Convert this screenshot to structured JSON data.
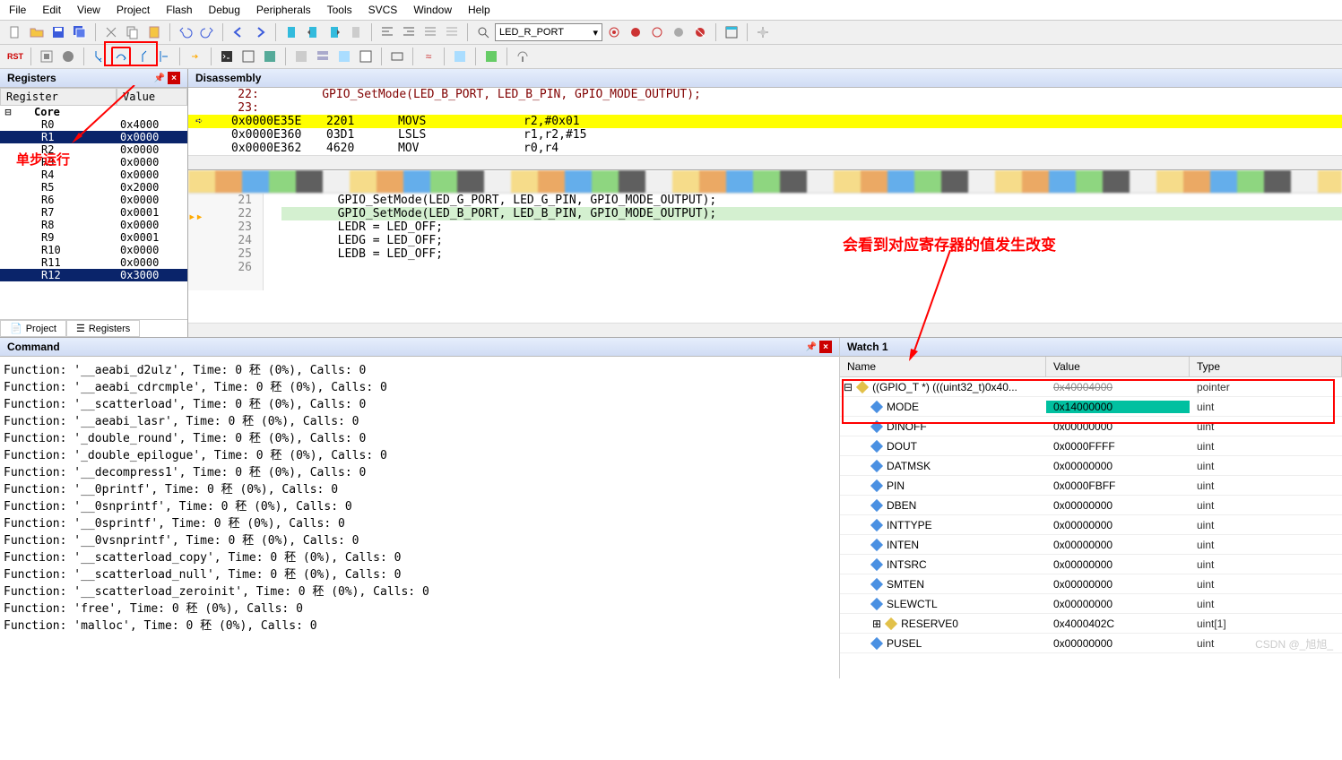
{
  "menu": [
    "File",
    "Edit",
    "View",
    "Project",
    "Flash",
    "Debug",
    "Peripherals",
    "Tools",
    "SVCS",
    "Window",
    "Help"
  ],
  "combo_target": "LED_R_PORT",
  "panes": {
    "registers": "Registers",
    "disassembly": "Disassembly",
    "command": "Command",
    "watch": "Watch 1"
  },
  "reg_header": {
    "name": "Register",
    "value": "Value"
  },
  "reg_group": "Core",
  "registers": [
    {
      "name": "R0",
      "val": "0x4000"
    },
    {
      "name": "R1",
      "val": "0x0000",
      "sel": true
    },
    {
      "name": "R2",
      "val": "0x0000"
    },
    {
      "name": "R3",
      "val": "0x0000"
    },
    {
      "name": "R4",
      "val": "0x0000"
    },
    {
      "name": "R5",
      "val": "0x2000"
    },
    {
      "name": "R6",
      "val": "0x0000"
    },
    {
      "name": "R7",
      "val": "0x0001"
    },
    {
      "name": "R8",
      "val": "0x0000"
    },
    {
      "name": "R9",
      "val": "0x0001"
    },
    {
      "name": "R10",
      "val": "0x0000"
    },
    {
      "name": "R11",
      "val": "0x0000"
    },
    {
      "name": "R12",
      "val": "0x3000",
      "sel": true
    }
  ],
  "reg_tabs": {
    "project": "Project",
    "registers": "Registers"
  },
  "disasm": {
    "src_line": "    22:         GPIO_SetMode(LED_B_PORT, LED_B_PIN, GPIO_MODE_OUTPUT);",
    "src_line_num": "    23:",
    "rows": [
      {
        "addr": "0x0000E35E",
        "op": "2201",
        "mn": "MOVS",
        "args": "r2,#0x01",
        "cur": true
      },
      {
        "addr": "0x0000E360",
        "op": "03D1",
        "mn": "LSLS",
        "args": "r1,r2,#15"
      },
      {
        "addr": "0x0000E362",
        "op": "4620",
        "mn": "MOV",
        "args": "r0,r4"
      }
    ]
  },
  "code": {
    "lines": [
      {
        "n": 21,
        "t": "        GPIO_SetMode(LED_G_PORT, LED_G_PIN, GPIO_MODE_OUTPUT);"
      },
      {
        "n": 22,
        "t": "        GPIO_SetMode(LED_B_PORT, LED_B_PIN, GPIO_MODE_OUTPUT);",
        "hl": true
      },
      {
        "n": 23,
        "t": ""
      },
      {
        "n": 24,
        "t": "        LEDR = LED_OFF;"
      },
      {
        "n": 25,
        "t": "        LEDG = LED_OFF;"
      },
      {
        "n": 26,
        "t": "        LEDB = LED_OFF;"
      }
    ]
  },
  "command_lines": [
    "Function: '__aeabi_d2ulz', Time: 0 秠 (0%), Calls: 0",
    "Function: '__aeabi_cdrcmple', Time: 0 秠 (0%), Calls: 0",
    "Function: '__scatterload', Time: 0 秠 (0%), Calls: 0",
    "Function: '__aeabi_lasr', Time: 0 秠 (0%), Calls: 0",
    "Function: '_double_round', Time: 0 秠 (0%), Calls: 0",
    "Function: '_double_epilogue', Time: 0 秠 (0%), Calls: 0",
    "Function: '__decompress1', Time: 0 秠 (0%), Calls: 0",
    "Function: '__0printf', Time: 0 秠 (0%), Calls: 0",
    "Function: '__0snprintf', Time: 0 秠 (0%), Calls: 0",
    "Function: '__0sprintf', Time: 0 秠 (0%), Calls: 0",
    "Function: '__0vsnprintf', Time: 0 秠 (0%), Calls: 0",
    "Function: '__scatterload_copy', Time: 0 秠 (0%), Calls: 0",
    "Function: '__scatterload_null', Time: 0 秠 (0%), Calls: 0",
    "Function: '__scatterload_zeroinit', Time: 0 秠 (0%), Calls: 0",
    "Function: 'free', Time: 0 秠 (0%), Calls: 0",
    "Function: 'malloc', Time: 0 秠 (0%), Calls: 0"
  ],
  "watch": {
    "head": {
      "name": "Name",
      "value": "Value",
      "type": "Type"
    },
    "root": {
      "name": "((GPIO_T *) (((uint32_t)0x40...",
      "value": "0x40004000",
      "type": "pointer"
    },
    "rows": [
      {
        "name": "MODE",
        "value": "0x14000000",
        "type": "uint",
        "hl": true
      },
      {
        "name": "DINOFF",
        "value": "0x00000000",
        "type": "uint"
      },
      {
        "name": "DOUT",
        "value": "0x0000FFFF",
        "type": "uint"
      },
      {
        "name": "DATMSK",
        "value": "0x00000000",
        "type": "uint"
      },
      {
        "name": "PIN",
        "value": "0x0000FBFF",
        "type": "uint"
      },
      {
        "name": "DBEN",
        "value": "0x00000000",
        "type": "uint"
      },
      {
        "name": "INTTYPE",
        "value": "0x00000000",
        "type": "uint"
      },
      {
        "name": "INTEN",
        "value": "0x00000000",
        "type": "uint"
      },
      {
        "name": "INTSRC",
        "value": "0x00000000",
        "type": "uint"
      },
      {
        "name": "SMTEN",
        "value": "0x00000000",
        "type": "uint"
      },
      {
        "name": "SLEWCTL",
        "value": "0x00000000",
        "type": "uint"
      },
      {
        "name": "RESERVE0",
        "value": "0x4000402C",
        "type": "uint[1]",
        "icon": "y",
        "exp": true
      },
      {
        "name": "PUSEL",
        "value": "0x00000000",
        "type": "uint"
      }
    ]
  },
  "annot": {
    "step": "单步运行",
    "change": "会看到对应寄存器的值发生改变"
  },
  "watermark": "CSDN @_旭旭_"
}
